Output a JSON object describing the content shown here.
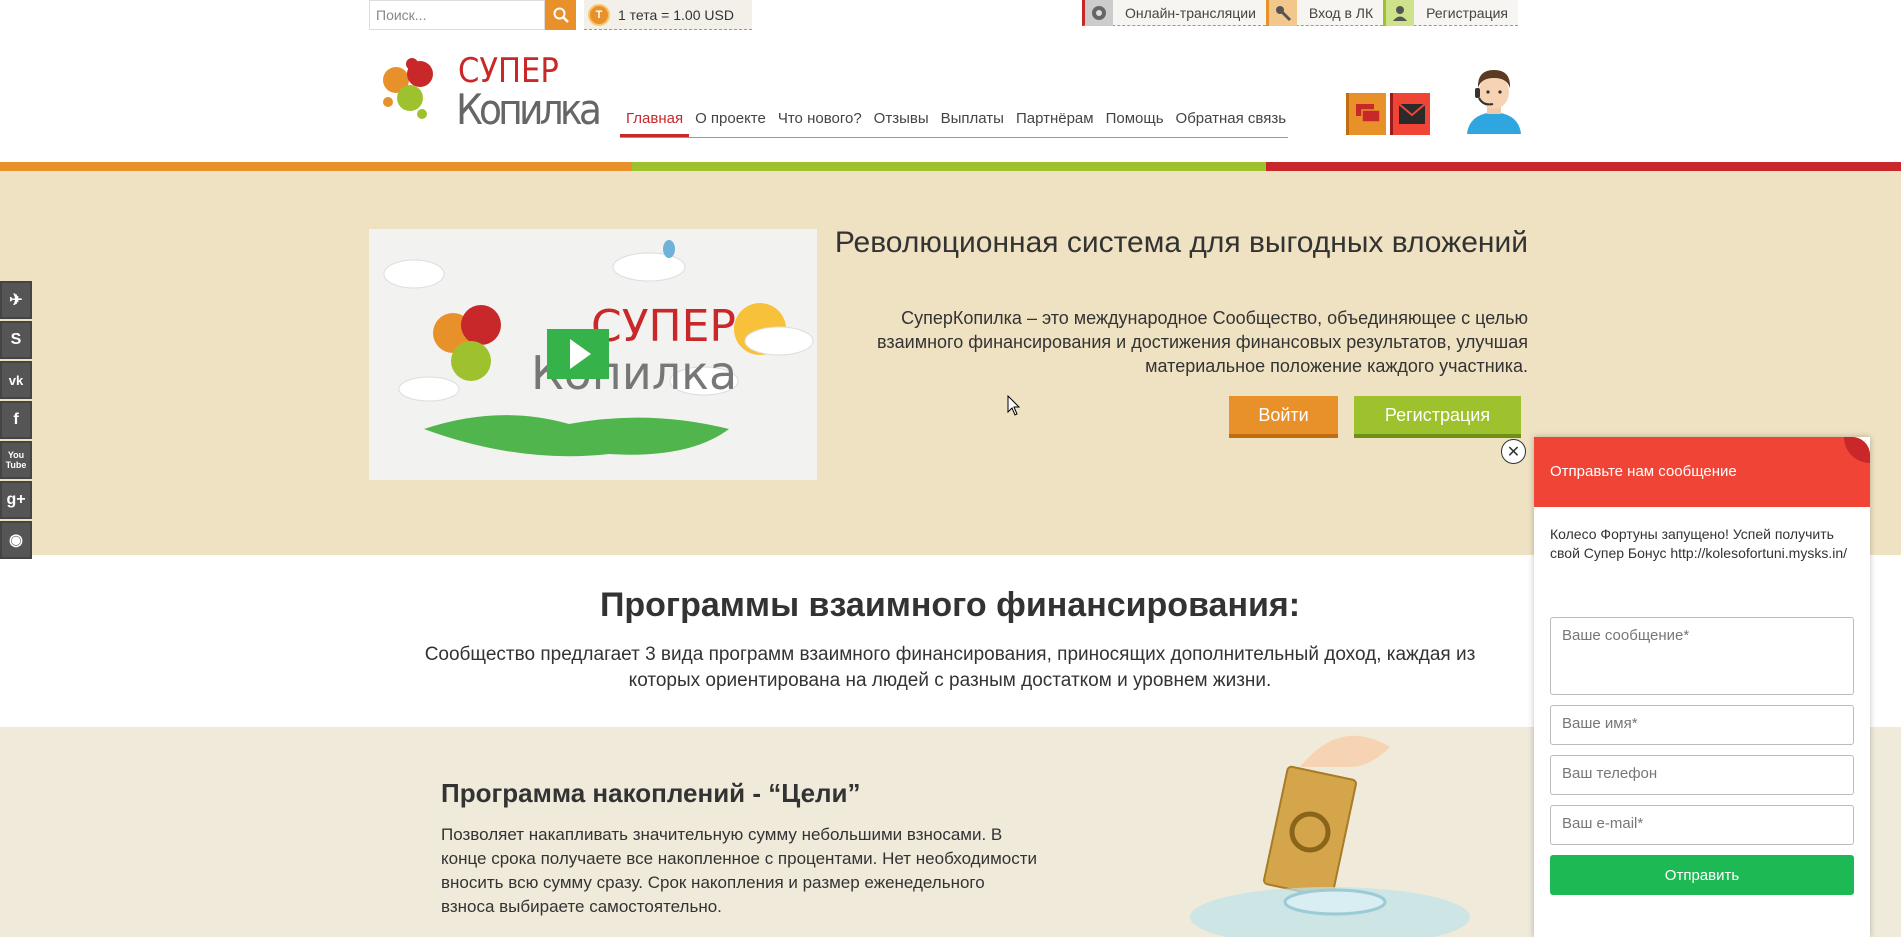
{
  "topbar": {
    "search_placeholder": "Поиск...",
    "rate": "1 тета = 1.00 USD",
    "coin_glyph": "T",
    "links": [
      "Онлайн-трансляции",
      "Вход в ЛК",
      "Регистрация"
    ]
  },
  "logo": {
    "line1": "СУПЕР",
    "line2": "Копилка"
  },
  "nav": [
    "Главная",
    "О проекте",
    "Что нового?",
    "Отзывы",
    "Выплаты",
    "Партнёрам",
    "Помощь",
    "Обратная связь"
  ],
  "hero": {
    "title": "Революционная система для выгодных вложений",
    "text": "СуперКопилка – это международное Сообщество, объединяющее с целью взаимного финансирования и достижения финансовых результатов, улучшая материальное положение каждого участника.",
    "login": "Войти",
    "register": "Регистрация",
    "video_logo1": "СУПЕР",
    "video_logo2": "Копилка"
  },
  "social": [
    "telegram-icon",
    "skype-icon",
    "vk-icon",
    "facebook-icon",
    "youtube-icon",
    "googleplus-icon",
    "rss-icon"
  ],
  "social_glyphs": [
    "✈",
    "S",
    "vk",
    "f",
    "You Tube",
    "g+",
    "◉"
  ],
  "programs": {
    "title": "Программы взаимного финансирования:",
    "text": "Сообщество предлагает 3 вида программ взаимного финансирования, приносящих дополнительный доход, каждая из которых ориентирована на людей с разным достатком и уровнем жизни."
  },
  "goal": {
    "title": "Программа накоплений - “Цели”",
    "text": "Позволяет накапливать значительную сумму небольшими взносами. В конце срока получаете все накопленное с процентами. Нет необходимости вносить всю сумму сразу. Срок накопления и размер еженедельного взноса выбираете самостоятельно."
  },
  "chat": {
    "title": "Отправьте нам сообщение",
    "message": "Колесо Фортуны запущено! Успей получить свой Супер Бонус http://kolesofortuni.mysks.in/",
    "placeholder_message": "Ваше сообщение*",
    "placeholder_name": "Ваше имя*",
    "placeholder_phone": "Ваш телефон",
    "placeholder_email": "Ваш e-mail*",
    "send": "Отправить"
  },
  "colors": {
    "orange": "#e8912b",
    "green": "#9ec22d",
    "red": "#c8282a",
    "hero_bg": "#efe2c2",
    "chat_red": "#f04536",
    "send_green": "#1db954"
  }
}
